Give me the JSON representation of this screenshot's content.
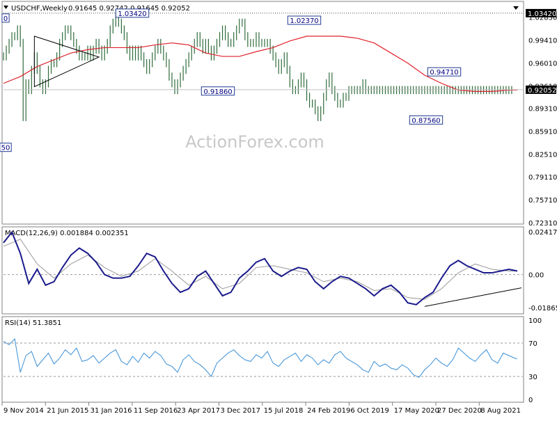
{
  "header": {
    "symbol": "USDCHF,Weekly",
    "ohlc": "0.91645 0.92742 0.91645 0.92052"
  },
  "watermark": "ActionForex.com",
  "colors": {
    "price_bars": "#2e6b3a",
    "moving_average": "#e0202a",
    "macd_line": "#1a1a8c",
    "signal_line": "#9a9a9a",
    "rsi_line": "#3a8fd6",
    "level_line": "#4b4b4b",
    "trendline": "#000000",
    "annotation_border": "#1f3a93"
  },
  "chart_data": [
    {
      "type": "line",
      "panel": "price",
      "ylim": [
        0.7231,
        1.0496
      ],
      "y_ticks": [
        "1.03420",
        "1.02830",
        "0.99410",
        "0.96010",
        "0.92610",
        "0.89310",
        "0.85910",
        "0.82510",
        "0.79110",
        "0.75710",
        "0.72310"
      ],
      "x_ticks": [
        "9 Nov 2014",
        "21 Jun 2015",
        "31 Jan 2016",
        "11 Sep 2016",
        "23 Apr 2017",
        "3 Dec 2017",
        "15 Jul 2018",
        "24 Feb 2019",
        "6 Oct 2019",
        "17 May 2020",
        "27 Dec 2020",
        "8 Aug 2021"
      ],
      "current_value": "0.92052",
      "level_line": {
        "value": 1.0342,
        "label": "1.03420"
      },
      "annotations": [
        {
          "label": "1.03420",
          "value": 1.0342
        },
        {
          "label": "1.02370",
          "value": 1.0237
        },
        {
          "label": "0.91860",
          "value": 0.9186
        },
        {
          "label": "0.94710",
          "value": 0.9471
        },
        {
          "label": "0.87560",
          "value": 0.8756
        },
        {
          "label": "0",
          "value": 1.027
        },
        {
          "label": "50",
          "value": 0.835
        }
      ],
      "series": [
        {
          "name": "close",
          "x_index": [
            0,
            2,
            4,
            6,
            8,
            10,
            12,
            14,
            16,
            18,
            20,
            22,
            24,
            26,
            28,
            30,
            32,
            34,
            36,
            38,
            40,
            42,
            44,
            46,
            48,
            50,
            52,
            54,
            56,
            58,
            60,
            62,
            64,
            66,
            68,
            70,
            72,
            74,
            76,
            78,
            80,
            82,
            84,
            86,
            88,
            90,
            92,
            94,
            96,
            98,
            100,
            102,
            104,
            106,
            108,
            110,
            112,
            114,
            116,
            118,
            120,
            122,
            124,
            126,
            128,
            130,
            132,
            134,
            136,
            138,
            140,
            142,
            144,
            146,
            148,
            150,
            152,
            154,
            156,
            158,
            160,
            162,
            164,
            166,
            168,
            170,
            172,
            174,
            176,
            178,
            180,
            182,
            184,
            186,
            188,
            190,
            192,
            194,
            196,
            198,
            200,
            202,
            204,
            206,
            208,
            210,
            212,
            214,
            216,
            218,
            220,
            222,
            224,
            226,
            228,
            230,
            232,
            234,
            236,
            238,
            240,
            242,
            244,
            246,
            248,
            250,
            252,
            254,
            256,
            258,
            260,
            262,
            264,
            266,
            268,
            270,
            272,
            274,
            276,
            278,
            280,
            282,
            284,
            286,
            288,
            290,
            292,
            294,
            296,
            298,
            300,
            302,
            304,
            306,
            308,
            310,
            312,
            314,
            316,
            318,
            320,
            322,
            324,
            326,
            328,
            330,
            332,
            334,
            336,
            338,
            340,
            342,
            344,
            346,
            348,
            350,
            352,
            354,
            356,
            358,
            360,
            362,
            364,
            366
          ],
          "values": [
            0.97,
            0.98,
            0.99,
            1.0,
            1.0,
            1.01,
            0.99,
            0.88,
            0.93,
            0.92,
            0.95,
            0.97,
            0.95,
            0.93,
            0.92,
            0.93,
            0.95,
            0.96,
            0.96,
            0.97,
            0.99,
            1.0,
            1.01,
            1.01,
            1.0,
            0.99,
            0.98,
            0.97,
            0.97,
            0.97,
            0.98,
            0.97,
            0.98,
            0.99,
            0.98,
            0.97,
            0.98,
            0.99,
            1.01,
            1.02,
            1.03,
            1.02,
            1.01,
            1.0,
            0.98,
            0.97,
            0.98,
            0.97,
            0.98,
            0.97,
            0.96,
            0.95,
            0.96,
            0.97,
            0.98,
            0.99,
            0.98,
            0.97,
            0.96,
            0.94,
            0.93,
            0.92,
            0.93,
            0.94,
            0.95,
            0.96,
            0.97,
            0.98,
            0.99,
            1.0,
            0.99,
            0.98,
            0.99,
            0.98,
            0.97,
            0.98,
            0.99,
            1.0,
            1.01,
            1.0,
            0.99,
            0.99,
            1.0,
            1.01,
            1.02,
            1.02,
            1.0,
            0.99,
            0.99,
            0.99,
            1.0,
            0.99,
            0.99,
            0.99,
            0.99,
            0.98,
            0.97,
            0.96,
            0.95,
            0.96,
            0.97,
            0.95,
            0.93,
            0.92,
            0.92,
            0.93,
            0.94,
            0.93,
            0.91,
            0.9,
            0.9,
            0.89,
            0.88,
            0.89,
            0.91,
            0.93,
            0.94,
            0.92,
            0.91,
            0.9,
            0.9,
            0.91,
            0.91,
            0.92,
            0.92,
            0.92,
            0.92,
            0.92,
            0.93,
            0.92,
            0.92,
            0.92,
            0.92,
            0.92,
            0.92,
            0.92,
            0.92,
            0.92,
            0.92,
            0.92,
            0.92,
            0.92,
            0.92,
            0.92,
            0.92,
            0.92,
            0.92,
            0.92,
            0.92,
            0.92,
            0.92,
            0.92,
            0.92,
            0.92,
            0.92,
            0.92,
            0.92,
            0.92,
            0.92,
            0.92,
            0.92,
            0.92,
            0.92,
            0.92,
            0.92,
            0.92,
            0.92,
            0.92,
            0.92,
            0.92,
            0.92,
            0.92,
            0.92,
            0.92,
            0.92,
            0.92,
            0.92,
            0.92,
            0.92,
            0.92,
            0.92,
            0.92
          ]
        },
        {
          "name": "moving-average",
          "x_index": [
            0,
            12,
            24,
            36,
            48,
            60,
            72,
            84,
            96,
            108,
            120,
            132,
            144,
            156,
            168,
            180,
            192,
            204,
            216,
            228,
            240,
            252,
            264,
            276,
            288,
            300,
            312,
            324,
            336,
            348,
            360,
            366
          ],
          "values": [
            0.93,
            0.94,
            0.955,
            0.965,
            0.975,
            0.98,
            0.983,
            0.983,
            0.983,
            0.987,
            0.99,
            0.987,
            0.975,
            0.97,
            0.97,
            0.977,
            0.983,
            0.993,
            1.0,
            1.0,
            1.0,
            0.997,
            0.99,
            0.975,
            0.96,
            0.942,
            0.93,
            0.92,
            0.918,
            0.918,
            0.92,
            0.92
          ]
        }
      ]
    },
    {
      "type": "line",
      "panel": "macd",
      "title": "MACD(12,26,9) 0.001884 0.002351",
      "ylim": [
        -0.0218,
        0.0262
      ],
      "y_ticks": [
        "0.024174",
        "0.00",
        "-0.018653"
      ],
      "trendline": {
        "from": {
          "x_index": 300,
          "value": -0.018
        },
        "to": {
          "x_index": 366,
          "value": -0.0075
        }
      },
      "series": [
        {
          "name": "MACD",
          "x_index": [
            0,
            6,
            12,
            18,
            24,
            30,
            36,
            42,
            48,
            54,
            60,
            66,
            72,
            78,
            84,
            90,
            96,
            102,
            108,
            114,
            120,
            126,
            132,
            138,
            144,
            150,
            156,
            162,
            168,
            174,
            180,
            186,
            192,
            198,
            204,
            210,
            216,
            222,
            228,
            234,
            240,
            246,
            252,
            258,
            264,
            270,
            276,
            282,
            288,
            294,
            300,
            306,
            312,
            318,
            324,
            330,
            336,
            342,
            348,
            354,
            360,
            366
          ],
          "values": [
            0.018,
            0.024,
            0.012,
            -0.005,
            0.003,
            -0.006,
            -0.004,
            0.004,
            0.011,
            0.015,
            0.012,
            0.007,
            0.0,
            -0.002,
            -0.002,
            -0.001,
            0.005,
            0.012,
            0.01,
            0.002,
            -0.005,
            -0.01,
            -0.008,
            -0.001,
            0.002,
            -0.005,
            -0.012,
            -0.01,
            -0.002,
            0.002,
            0.007,
            0.009,
            0.002,
            -0.001,
            0.002,
            0.004,
            0.003,
            -0.004,
            -0.008,
            -0.004,
            -0.001,
            -0.002,
            -0.005,
            -0.008,
            -0.012,
            -0.008,
            -0.006,
            -0.01,
            -0.016,
            -0.017,
            -0.013,
            -0.01,
            -0.002,
            0.005,
            0.008,
            0.005,
            0.003,
            0.001,
            0.001,
            0.002,
            0.003,
            0.002
          ]
        },
        {
          "name": "signal",
          "x_index": [
            0,
            12,
            24,
            36,
            48,
            60,
            72,
            84,
            96,
            108,
            120,
            132,
            144,
            156,
            168,
            180,
            192,
            204,
            216,
            228,
            240,
            252,
            264,
            276,
            288,
            300,
            312,
            324,
            336,
            348,
            360,
            366
          ],
          "values": [
            0.016,
            0.02,
            0.006,
            -0.002,
            0.006,
            0.011,
            0.004,
            -0.001,
            0.002,
            0.009,
            0.002,
            -0.006,
            -0.001,
            -0.008,
            -0.005,
            0.004,
            0.005,
            0.003,
            0.001,
            -0.004,
            -0.002,
            -0.004,
            -0.009,
            -0.008,
            -0.013,
            -0.014,
            -0.008,
            0.001,
            0.006,
            0.003,
            0.002,
            0.002
          ]
        }
      ]
    },
    {
      "type": "line",
      "panel": "rsi",
      "title": "RSI(14) 51.3851",
      "ylim": [
        0,
        100
      ],
      "y_ticks": [
        "100",
        "70",
        "30",
        "0"
      ],
      "guides": [
        70,
        30
      ],
      "series": [
        {
          "name": "RSI",
          "x_index": [
            0,
            4,
            8,
            12,
            16,
            20,
            24,
            28,
            32,
            36,
            40,
            44,
            48,
            52,
            56,
            60,
            64,
            68,
            72,
            76,
            80,
            84,
            88,
            92,
            96,
            100,
            104,
            108,
            112,
            116,
            120,
            124,
            128,
            132,
            136,
            140,
            144,
            148,
            152,
            156,
            160,
            164,
            168,
            172,
            176,
            180,
            184,
            188,
            192,
            196,
            200,
            204,
            208,
            212,
            216,
            220,
            224,
            228,
            232,
            236,
            240,
            244,
            248,
            252,
            256,
            260,
            264,
            268,
            272,
            276,
            280,
            284,
            288,
            292,
            296,
            300,
            304,
            308,
            312,
            316,
            320,
            324,
            328,
            332,
            336,
            340,
            344,
            348,
            352,
            356,
            360,
            364,
            366
          ],
          "values": [
            72,
            68,
            75,
            35,
            55,
            60,
            42,
            50,
            58,
            45,
            52,
            62,
            56,
            64,
            48,
            50,
            55,
            46,
            52,
            58,
            62,
            48,
            44,
            54,
            47,
            58,
            52,
            60,
            55,
            45,
            42,
            35,
            50,
            56,
            48,
            44,
            38,
            30,
            46,
            52,
            58,
            62,
            55,
            50,
            48,
            56,
            52,
            60,
            46,
            42,
            50,
            54,
            58,
            48,
            56,
            52,
            44,
            50,
            46,
            56,
            60,
            52,
            48,
            44,
            38,
            35,
            48,
            42,
            45,
            40,
            38,
            44,
            40,
            32,
            29,
            38,
            44,
            52,
            46,
            42,
            50,
            64,
            58,
            52,
            48,
            56,
            62,
            50,
            46,
            58,
            55,
            52,
            51
          ]
        }
      ]
    }
  ]
}
